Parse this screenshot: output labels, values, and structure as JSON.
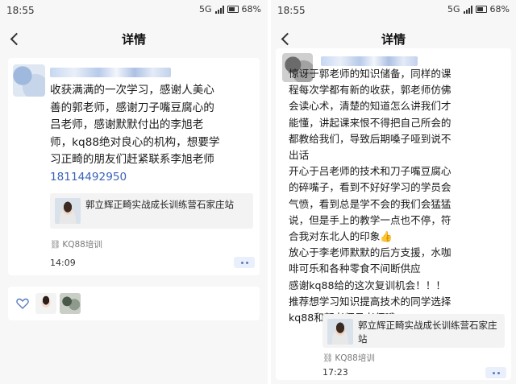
{
  "left": {
    "status": {
      "time": "18:55",
      "network": "5G",
      "battery": "68%"
    },
    "nav": {
      "title": "详情"
    },
    "post": {
      "lines": [
        "收获满满的一次学习，感谢人美心",
        "善的郭老师，感谢刀子嘴豆腐心的",
        "吕老师，感谢默默付出的李旭老",
        "师，kq88绝对良心的机构，想要学",
        "习正畸的朋友们赶紧联系李旭老师",
        "18114492950"
      ],
      "link_card": {
        "title": "郭立辉正畸实战成长训练营石家庄站"
      },
      "source": "KQ88培训",
      "time": "14:09"
    }
  },
  "right": {
    "status": {
      "time": "18:55",
      "network": "5G",
      "battery": "68%"
    },
    "nav": {
      "title": "详情"
    },
    "post": {
      "lines": [
        "惊讶于郭老师的知识储备，同样的课",
        "程每次学都有新的收获，郭老师仿佛",
        "会读心术，清楚的知道怎么讲我们才",
        "能懂，讲起课来恨不得把自己所会的",
        "都教给我们，导致后期嗓子哑到说不",
        "出话",
        "开心于吕老师的技术和刀子嘴豆腐心",
        "的碎嘴子，看到不好好学习的学员会",
        "气愤，看到总是学不会的我们会猛猛",
        "说，但是手上的教学一点也不停，符",
        "合我对东北人的印象👍",
        "放心于李老师默默的后方支援，水咖",
        "啡可乐和各种零食不间断供应",
        "感谢kq88给的这次复训机会！！！",
        "推荐想学习知识提高技术的同学选择",
        "kq88和郭老师吕老师哦~"
      ],
      "link_card": {
        "title": "郭立辉正畸实战成长训练营石家庄站"
      },
      "source": "KQ88培训",
      "time": "17:23"
    }
  },
  "icons": {
    "back": "chevron-left-icon",
    "like": "heart-outline-icon",
    "more": "more-dots-icon",
    "link": "link-icon"
  },
  "colors": {
    "more_button_bg": "#eaf0fb",
    "more_dots": "#5b7bc0",
    "page_bg": "#f7f7f7"
  }
}
